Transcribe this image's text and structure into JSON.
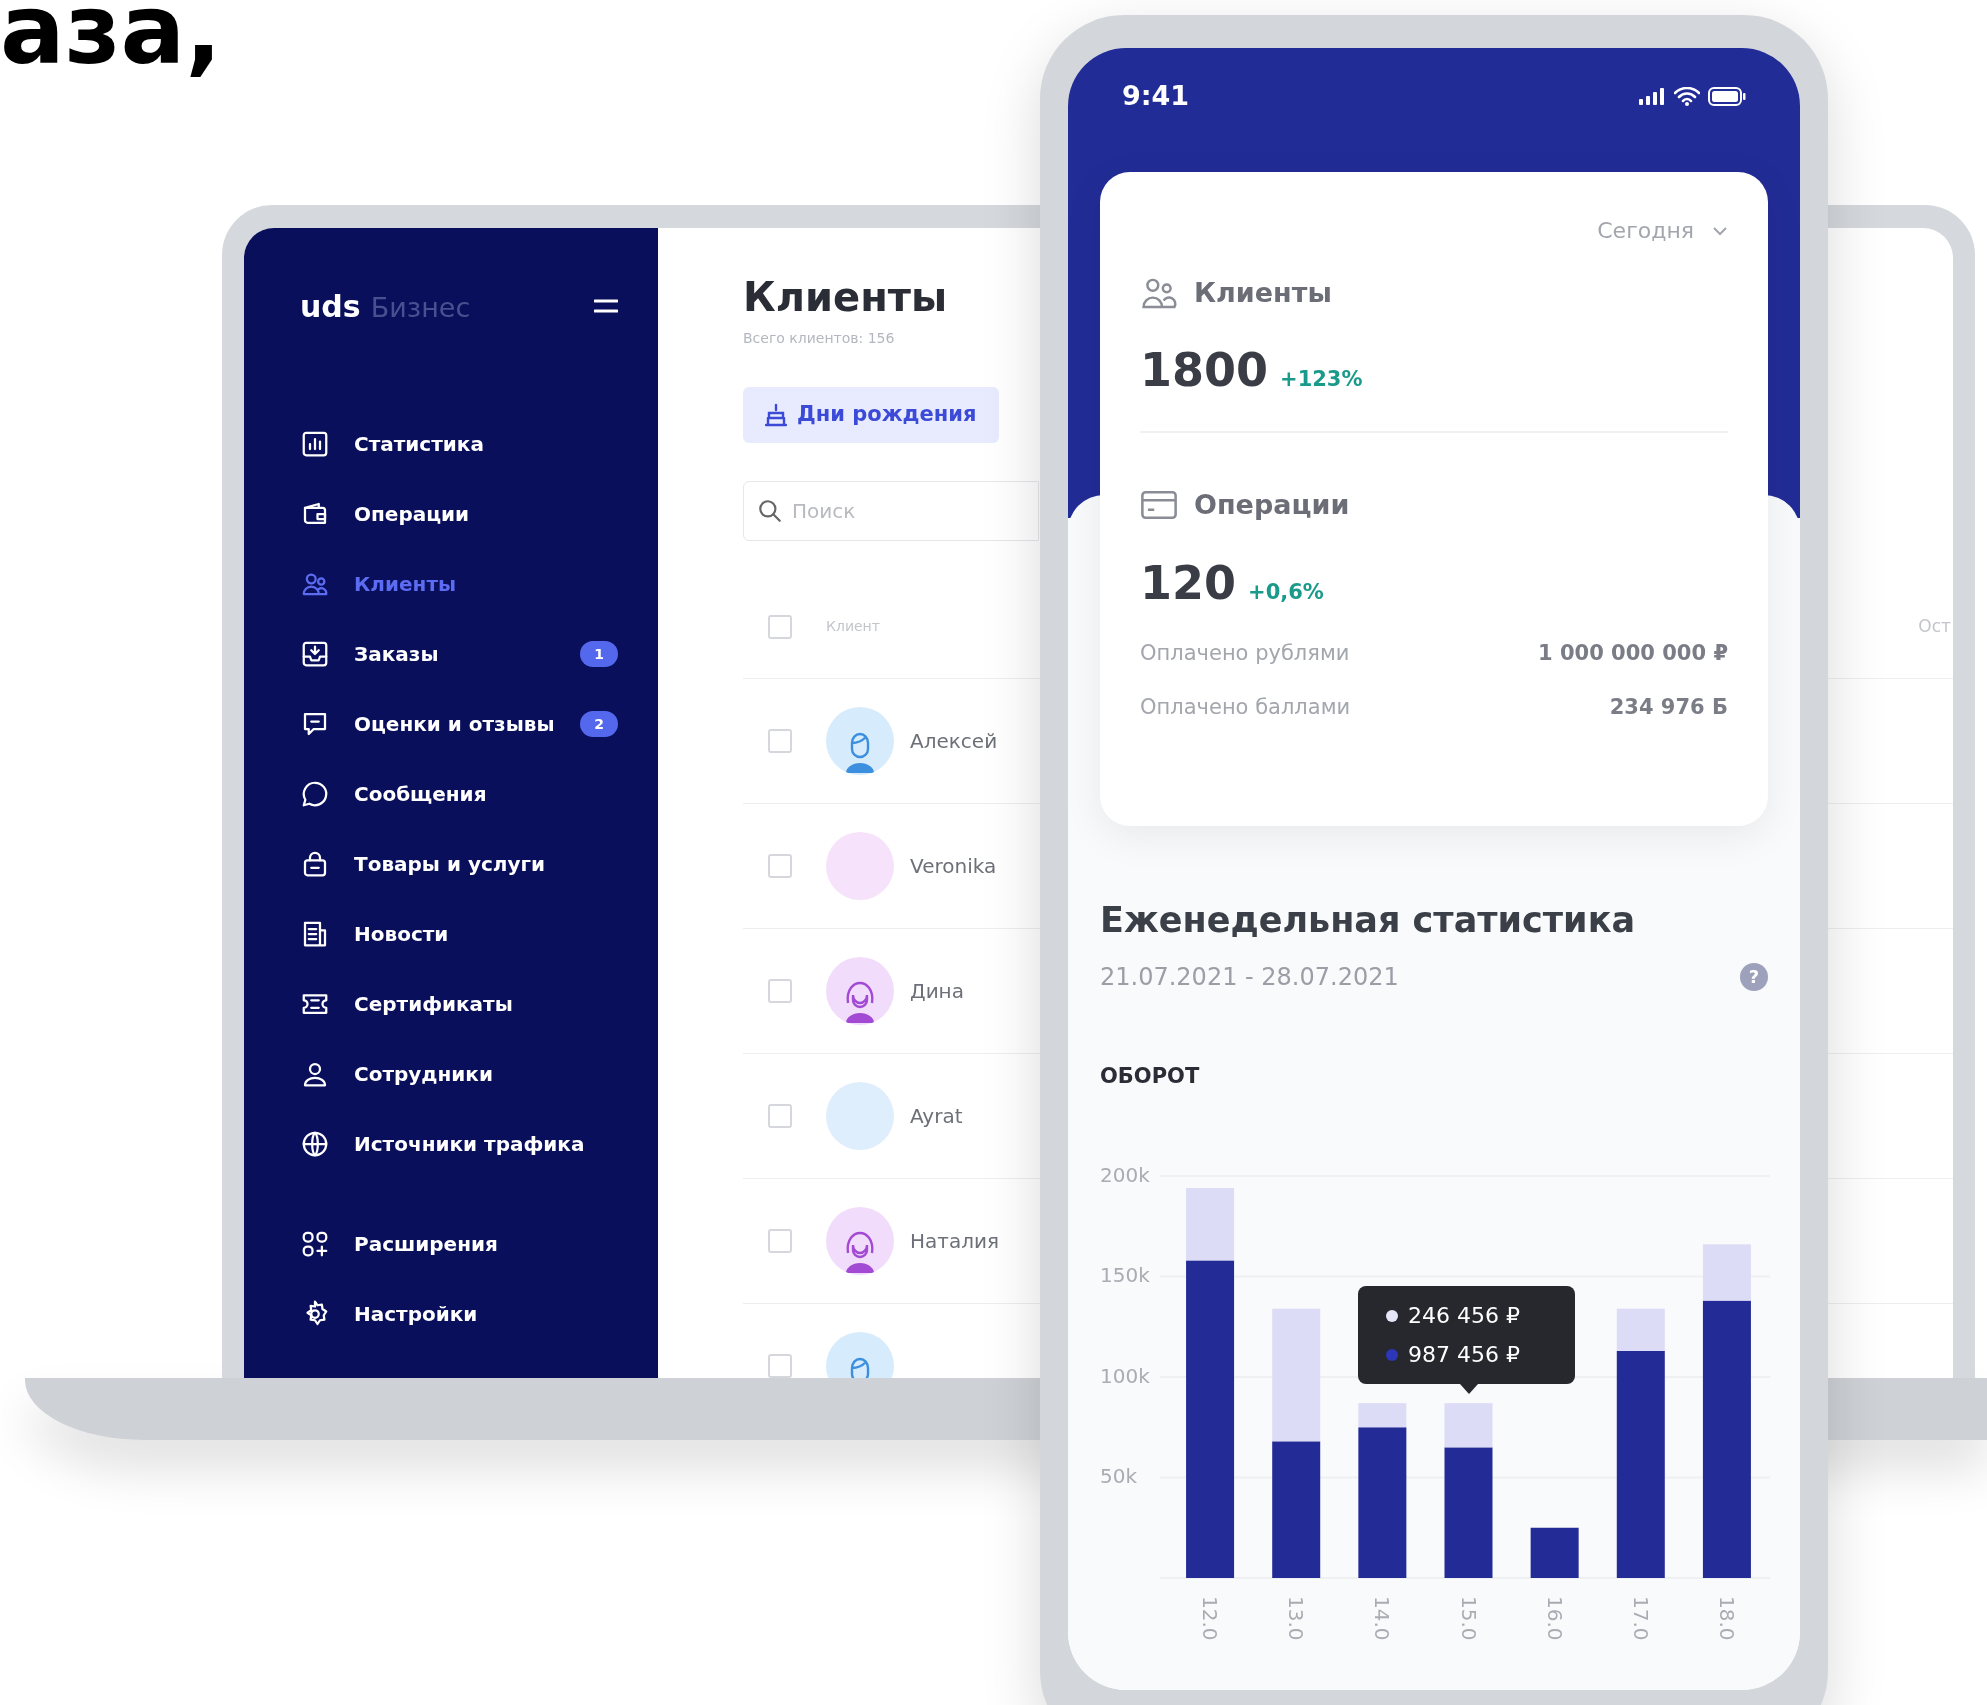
{
  "headline": "аза,",
  "laptop": {
    "sidebar": {
      "logo": "uds",
      "logo_suffix": "Бизнес",
      "items": [
        {
          "label": "Статистика",
          "selected": false
        },
        {
          "label": "Операции",
          "selected": false
        },
        {
          "label": "Клиенты",
          "selected": true
        },
        {
          "label": "Заказы",
          "selected": false,
          "badge": "1"
        },
        {
          "label": "Оценки и отзывы",
          "selected": false,
          "badge": "2"
        },
        {
          "label": "Сообщения",
          "selected": false
        },
        {
          "label": "Товары и услуги",
          "selected": false
        },
        {
          "label": "Новости",
          "selected": false
        },
        {
          "label": "Сертификаты",
          "selected": false
        },
        {
          "label": "Сотрудники",
          "selected": false
        },
        {
          "label": "Источники трафика",
          "selected": false
        }
      ],
      "bottom_items": [
        {
          "label": "Расширения",
          "selected": false
        },
        {
          "label": "Настройки",
          "selected": false
        }
      ]
    },
    "content": {
      "title": "Клиенты",
      "subtitle": "Всего клиентов: 156",
      "birthday_button": "Дни рождения",
      "search": {
        "placeholder": "Поиск"
      },
      "table": {
        "columns": [
          "Клиент",
          "Ост"
        ],
        "header_checked": false,
        "rows": [
          {
            "name": "Алексей",
            "kind": "male",
            "color": "#d6ebfb",
            "checked": false
          },
          {
            "name": "Veronika",
            "kind": "blank",
            "color": "#f6e2fb",
            "checked": false
          },
          {
            "name": "Дина",
            "kind": "female",
            "color": "#f1dcfb",
            "checked": false
          },
          {
            "name": "Ayrat",
            "kind": "blank",
            "color": "#deeefc",
            "checked": false
          },
          {
            "name": "Наталия",
            "kind": "female",
            "color": "#f1dcfb",
            "checked": false
          },
          {
            "kind": "male",
            "color": "#d6ebfb",
            "checked": false
          }
        ]
      }
    }
  },
  "phone": {
    "status_bar": {
      "time": "9:41"
    },
    "summary": {
      "period": "Сегодня",
      "clients": {
        "label": "Клиенты",
        "value": "1800",
        "change": "+123%"
      },
      "operations": {
        "label": "Операции",
        "value": "120",
        "change": "+0,6%",
        "rows": [
          {
            "label": "Оплачено рублями",
            "value": "1 000 000 000 ₽"
          },
          {
            "label": "Оплачено баллами",
            "value": "234 976 Б"
          }
        ]
      }
    },
    "weekly": {
      "title": "Еженедельная статистика",
      "date_range": "21.07.2021 - 28.07.2021",
      "help_icon": "?",
      "chart_title": "ОБОРОТ",
      "chart_data": {
        "type": "bar",
        "stacked": true,
        "grid": true,
        "categories": [
          "12.0",
          "13.0",
          "14.0",
          "15.0",
          "16.0",
          "17.0",
          "18.0"
        ],
        "ylim": [
          0,
          200000
        ],
        "yticks": [
          {
            "value": 50000,
            "label": "50k"
          },
          {
            "value": 100000,
            "label": "100k"
          },
          {
            "value": 150000,
            "label": "150k"
          },
          {
            "value": 200000,
            "label": "200k"
          }
        ],
        "series": [
          {
            "color": "#232c96",
            "values": [
              158000,
              68000,
              75000,
              65000,
              25000,
              113000,
              138000
            ]
          },
          {
            "color": "#dcdcf7",
            "values": [
              36000,
              66000,
              12000,
              22000,
              0,
              21000,
              28000
            ]
          }
        ]
      },
      "tooltip": [
        {
          "color": "#e6e6fa",
          "text": "246 456 ₽"
        },
        {
          "color": "#2b36b8",
          "text": "987 456 ₽"
        }
      ]
    }
  }
}
